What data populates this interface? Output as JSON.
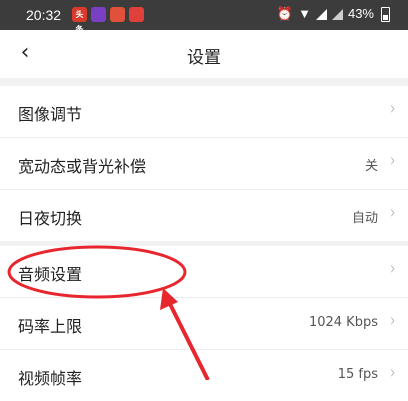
{
  "status_bar": {
    "time": "20:32",
    "battery": "43%",
    "app_icons": [
      {
        "name": "news-app-icon",
        "color": "#d93a2b",
        "text": "头条"
      },
      {
        "name": "video-app-icon",
        "color": "#7b3fc4",
        "text": ""
      },
      {
        "name": "game-app-icon",
        "color": "#e0503a",
        "text": ""
      },
      {
        "name": "chat-app-icon",
        "color": "#e0403a",
        "text": ""
      }
    ]
  },
  "header": {
    "back_icon": "‹",
    "title": "设置"
  },
  "groups": [
    {
      "rows": [
        {
          "label": "图像调节",
          "value": ""
        },
        {
          "label": "宽动态或背光补偿",
          "value": "关"
        },
        {
          "label": "日夜切换",
          "value": "自动"
        }
      ]
    },
    {
      "rows": [
        {
          "label": "音频设置",
          "value": ""
        },
        {
          "label": "码率上限",
          "value": "1024 Kbps"
        },
        {
          "label": "视频帧率",
          "value": "15 fps"
        }
      ]
    }
  ],
  "chevron": "›",
  "annotation_color": "#e8262e"
}
